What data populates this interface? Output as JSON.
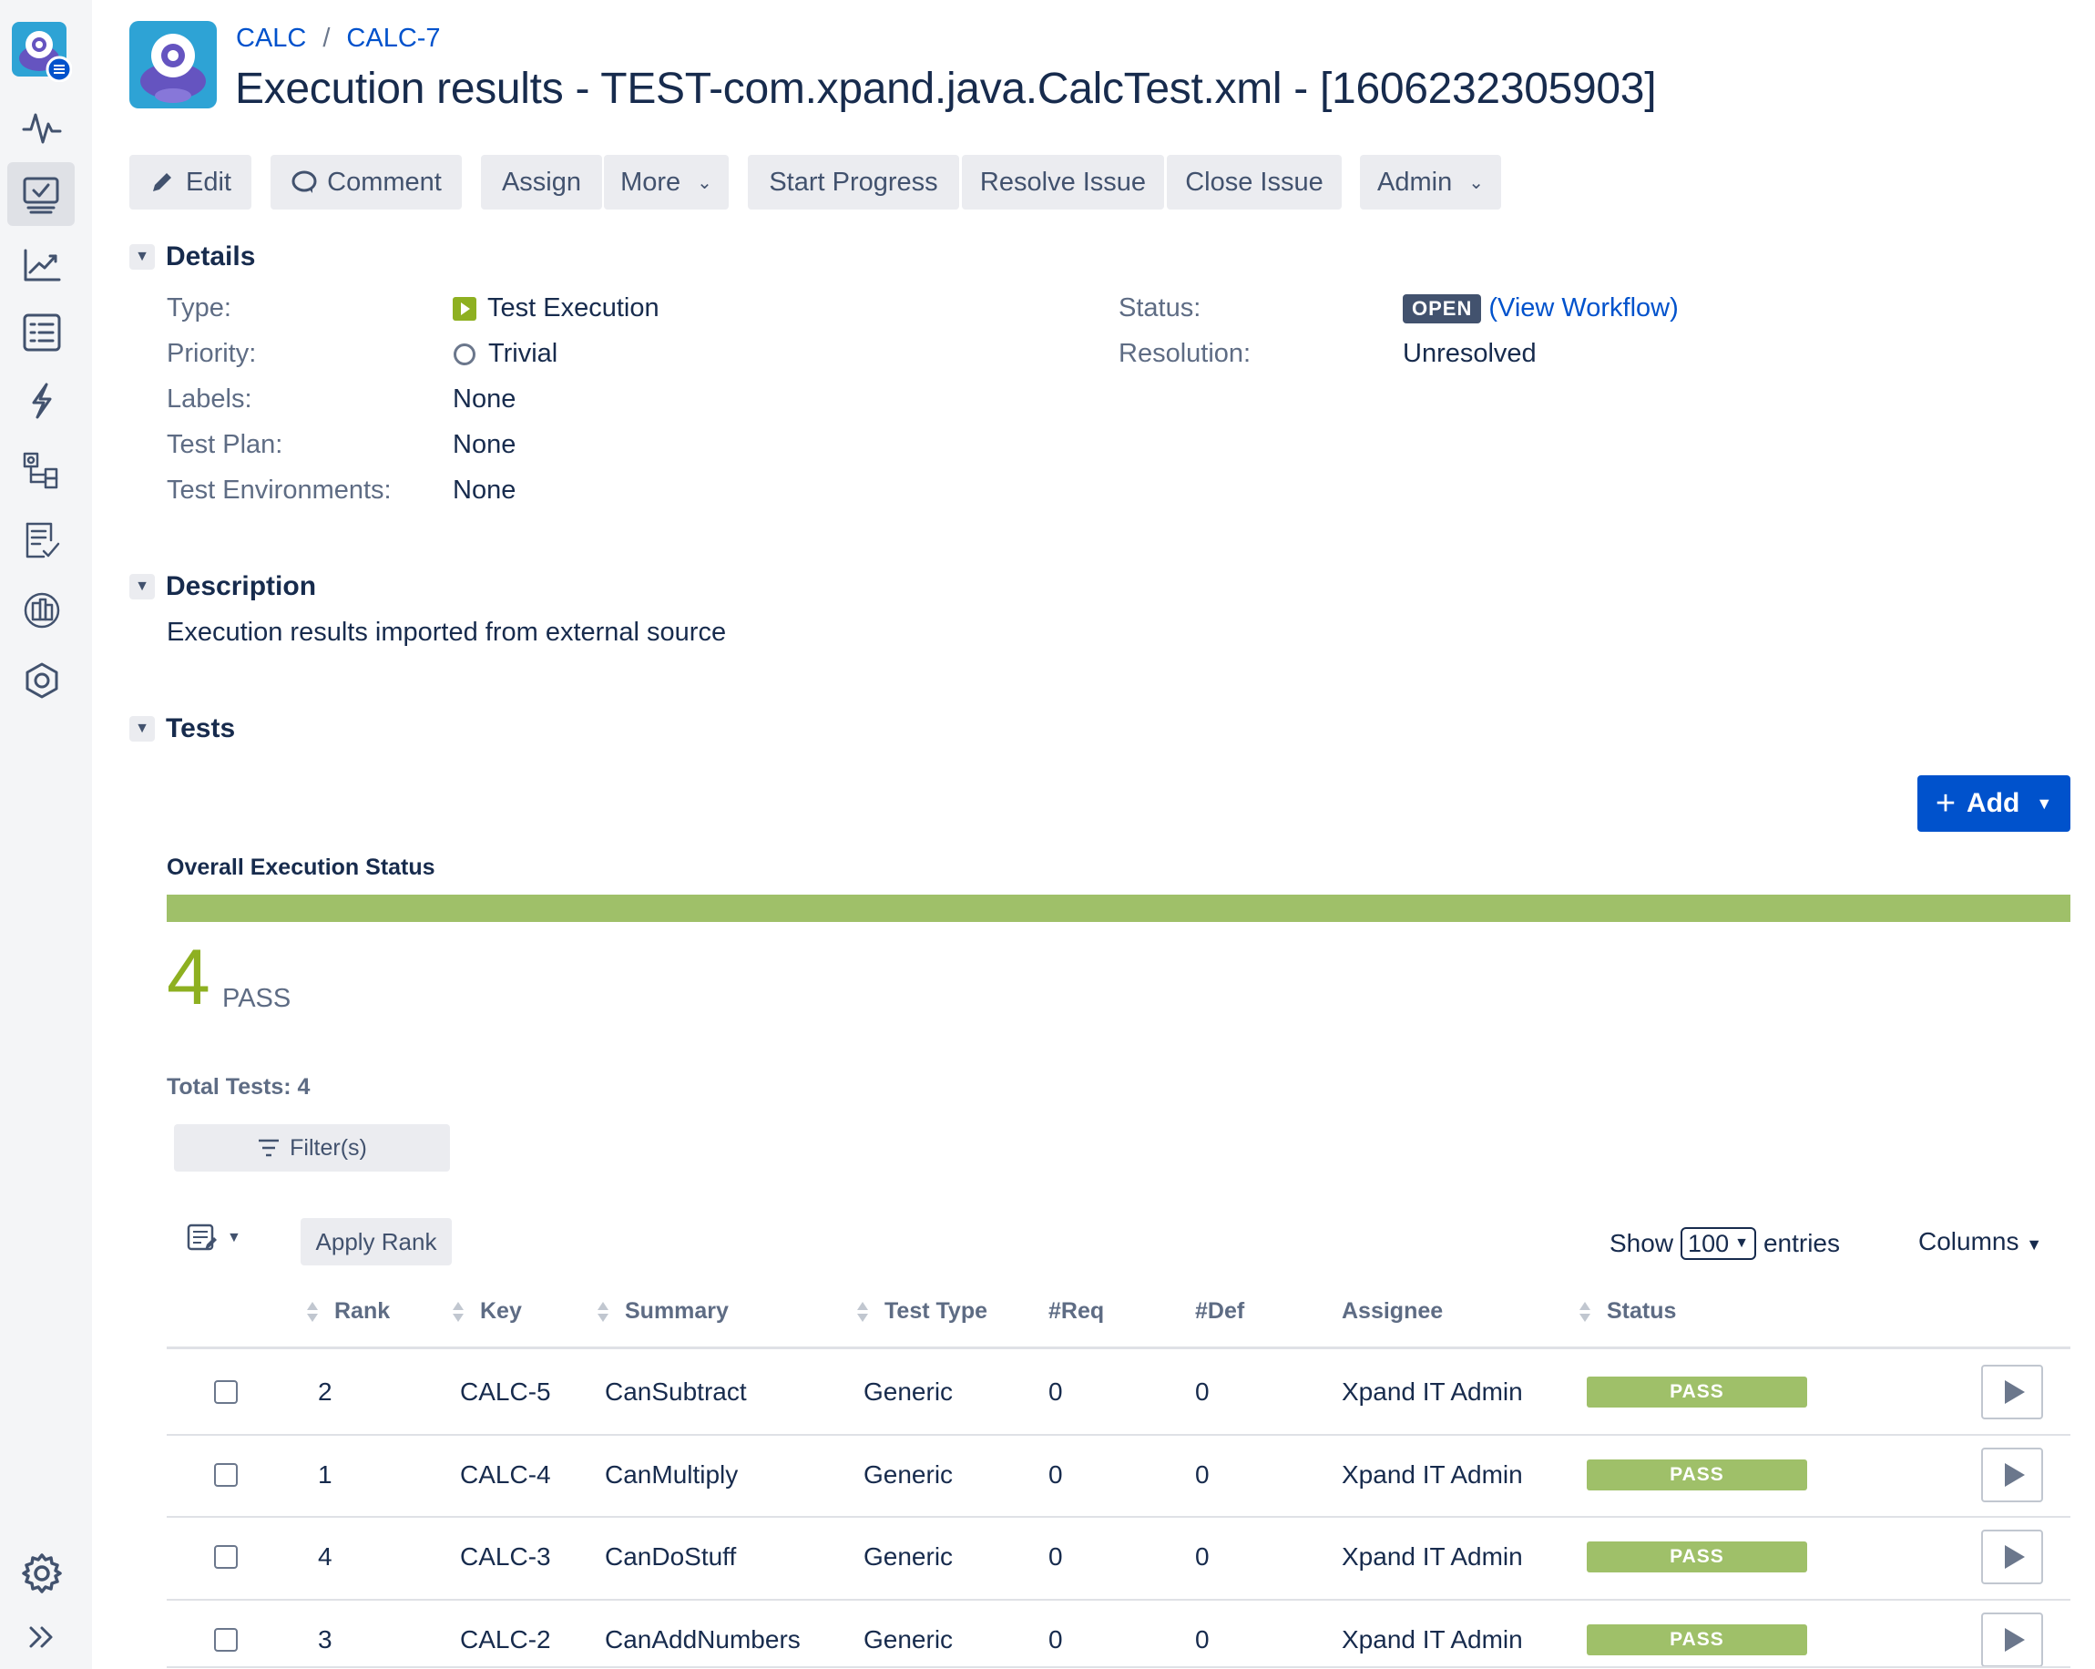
{
  "breadcrumb": {
    "project": "CALC",
    "issue": "CALC-7",
    "separator": "/"
  },
  "title": "Execution results - TEST-com.xpand.java.CalcTest.xml - [1606232305903]",
  "toolbar": {
    "edit": "Edit",
    "comment": "Comment",
    "assign": "Assign",
    "more": "More",
    "start_progress": "Start Progress",
    "resolve_issue": "Resolve Issue",
    "close_issue": "Close Issue",
    "admin": "Admin"
  },
  "details": {
    "heading": "Details",
    "type_label": "Type:",
    "type_value": "Test Execution",
    "priority_label": "Priority:",
    "priority_value": "Trivial",
    "labels_label": "Labels:",
    "labels_value": "None",
    "testplan_label": "Test Plan:",
    "testplan_value": "None",
    "testenv_label": "Test Environments:",
    "testenv_value": "None",
    "status_label": "Status:",
    "status_value": "OPEN",
    "view_workflow": "View Workflow",
    "resolution_label": "Resolution:",
    "resolution_value": "Unresolved"
  },
  "description": {
    "heading": "Description",
    "text": "Execution results imported from external source"
  },
  "tests": {
    "heading": "Tests",
    "add_label": "Add",
    "overall_label": "Overall Execution Status",
    "pass_fraction": 1.0,
    "pass_count": "4",
    "pass_label": "PASS",
    "total_tests": "Total Tests: 4",
    "filter_label": "Filter(s)",
    "apply_rank": "Apply Rank",
    "show_label": "Show",
    "entries_value": "100",
    "entries_label": "entries",
    "columns_label": "Columns",
    "headers": [
      "Rank",
      "Key",
      "Summary",
      "Test Type",
      "#Req",
      "#Def",
      "Assignee",
      "Status"
    ],
    "rows": [
      {
        "rank": "2",
        "key": "CALC-5",
        "summary": "CanSubtract",
        "type": "Generic",
        "req": "0",
        "def": "0",
        "assignee": "Xpand IT Admin",
        "status": "PASS"
      },
      {
        "rank": "1",
        "key": "CALC-4",
        "summary": "CanMultiply",
        "type": "Generic",
        "req": "0",
        "def": "0",
        "assignee": "Xpand IT Admin",
        "status": "PASS"
      },
      {
        "rank": "4",
        "key": "CALC-3",
        "summary": "CanDoStuff",
        "type": "Generic",
        "req": "0",
        "def": "0",
        "assignee": "Xpand IT Admin",
        "status": "PASS"
      },
      {
        "rank": "3",
        "key": "CALC-2",
        "summary": "CanAddNumbers",
        "type": "Generic",
        "req": "0",
        "def": "0",
        "assignee": "Xpand IT Admin",
        "status": "PASS"
      }
    ]
  },
  "colors": {
    "accent": "#0052cc",
    "pass": "#9fc069",
    "text": "#172b4d",
    "muted": "#5e6c84",
    "lozenge": "#42526e"
  },
  "icons": [
    "app-logo-icon",
    "activity-icon",
    "board-icon",
    "reports-icon",
    "test-list-icon",
    "bolt-icon",
    "components-icon",
    "checklist-icon",
    "repository-icon",
    "hexagon-icon",
    "settings-icon",
    "expand-icon"
  ]
}
